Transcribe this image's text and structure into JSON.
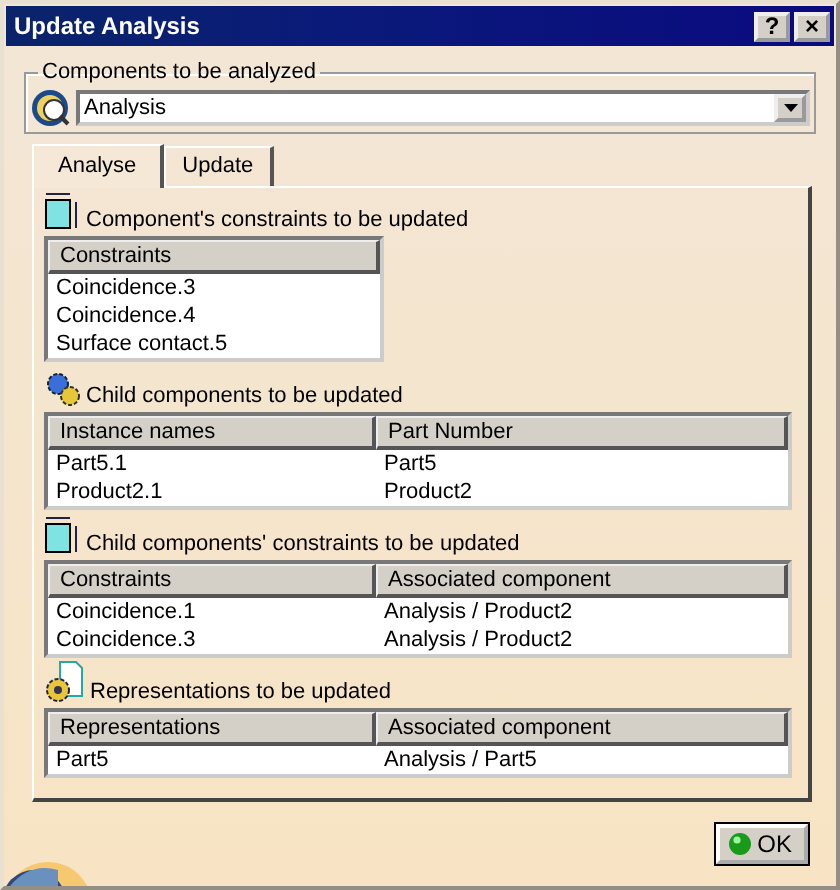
{
  "window": {
    "title": "Update Analysis"
  },
  "title_buttons": [
    "?",
    "×"
  ],
  "components": {
    "label": "Components to be analyzed",
    "value": "Analysis"
  },
  "tabs": [
    {
      "label": "Analyse",
      "selected": true
    },
    {
      "label": "Update",
      "selected": false
    }
  ],
  "sections": [
    {
      "kind": "constraints",
      "title": "Component's constraints to be updated",
      "columns": [
        "Constraints"
      ],
      "rows": [
        [
          "Coincidence.3"
        ],
        [
          "Coincidence.4"
        ],
        [
          "Surface contact.5"
        ]
      ]
    },
    {
      "kind": "components",
      "title": "Child components to be updated",
      "columns": [
        "Instance names",
        "Part Number"
      ],
      "rows": [
        [
          "Part5.1",
          "Part5"
        ],
        [
          "Product2.1",
          "Product2"
        ]
      ]
    },
    {
      "kind": "constraints",
      "title": "Child components' constraints to be updated",
      "columns": [
        "Constraints",
        "Associated component"
      ],
      "rows": [
        [
          "Coincidence.1",
          "Analysis / Product2"
        ],
        [
          "Coincidence.3",
          "Analysis / Product2"
        ]
      ]
    },
    {
      "kind": "representations",
      "title": "Representations to be updated",
      "columns": [
        "Representations",
        "Associated component"
      ],
      "rows": [
        [
          "Part5",
          "Analysis / Part5"
        ]
      ]
    }
  ],
  "ok_button": "OK"
}
